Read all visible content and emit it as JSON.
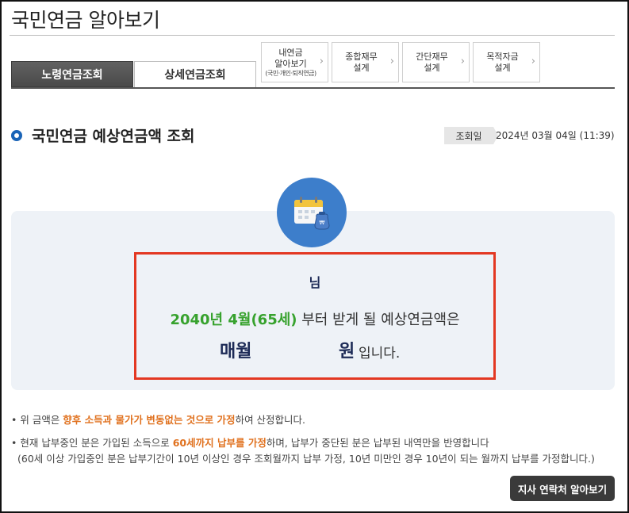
{
  "page": {
    "title": "국민연금 알아보기"
  },
  "tabs": {
    "main": [
      {
        "label": "노령연금조회",
        "active": true
      },
      {
        "label": "상세연금조회",
        "active": false
      }
    ],
    "small": [
      {
        "line1": "내연금",
        "line2": "알아보기",
        "sub": "(국민·개인·퇴직연금)",
        "chevron": "›"
      },
      {
        "line1": "종합재무",
        "line2": "설계",
        "chevron": "›"
      },
      {
        "line1": "간단재무",
        "line2": "설계",
        "chevron": "›"
      },
      {
        "line1": "목적자금",
        "line2": "설계",
        "chevron": "›"
      }
    ]
  },
  "section": {
    "title": "국민연금 예상연금액 조회",
    "lookup_label": "조회일",
    "lookup_date": "2024년 03월 04일 (11:39)"
  },
  "result": {
    "icon": "calendar-money-icon",
    "name_suffix": "님",
    "start_period": "2040년 4월(65세)",
    "period_rest": " 부터 받게 될 예상연금액은",
    "monthly_label": "매월",
    "won_label": "원",
    "amount_suffix": "입니다."
  },
  "notes": {
    "n1_prefix": "• 위 금액은 ",
    "n1_emphasis": "향후 소득과 물가가 변동없는 것으로 가정",
    "n1_suffix": "하여 산정합니다.",
    "n2_prefix": "• 현재 납부중인 분은 가입된 소득으로 ",
    "n2_emphasis": "60세까지 납부를 가정",
    "n2_suffix": "하며, 납부가 중단된 분은 납부된 내역만을 반영합니다",
    "n3": "(60세 이상 가입중인 분은 납부기간이 10년 이상인 경우 조회월까지 납부 가정, 10년 미만인 경우 10년이 되는 월까지 납부를 가정합니다.)"
  },
  "contact_button": {
    "label": "지사 연락처 알아보기"
  },
  "colors": {
    "accent_blue": "#1a64b7",
    "highlight_red": "#e33822",
    "green": "#37a22e",
    "orange": "#e0711e",
    "navy": "#1d2b57"
  }
}
